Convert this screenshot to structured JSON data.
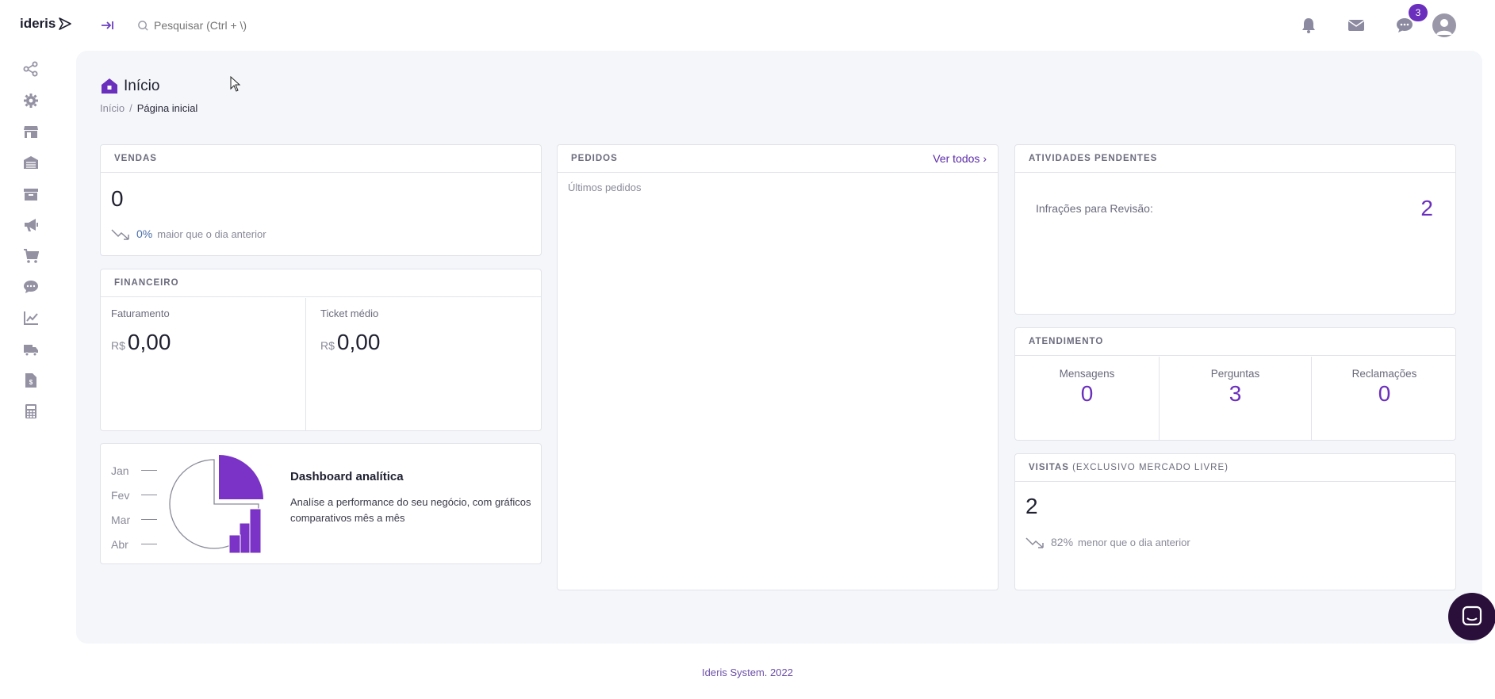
{
  "app": {
    "logo": "ideris"
  },
  "search": {
    "placeholder": "Pesquisar (Ctrl + \\)"
  },
  "header": {
    "chat_badge": "3"
  },
  "sidebar": {
    "items": [
      {
        "icon": "share-icon"
      },
      {
        "icon": "gear-icon"
      },
      {
        "icon": "store-icon"
      },
      {
        "icon": "warehouse-icon"
      },
      {
        "icon": "archive-icon"
      },
      {
        "icon": "megaphone-icon"
      },
      {
        "icon": "cart-icon"
      },
      {
        "icon": "chat-icon"
      },
      {
        "icon": "chart-line-icon"
      },
      {
        "icon": "truck-icon"
      },
      {
        "icon": "invoice-icon"
      },
      {
        "icon": "calculator-icon"
      }
    ]
  },
  "page": {
    "title": "Início",
    "breadcrumb": {
      "root": "Início",
      "separator": "/",
      "current": "Página inicial"
    }
  },
  "vendas": {
    "header": "VENDAS",
    "value": "0",
    "trend_pct": "0%",
    "trend_text": "maior que o dia anterior"
  },
  "financeiro": {
    "header": "FINANCEIRO",
    "faturamento_label": "Faturamento",
    "faturamento_currency": "R$",
    "faturamento_value": "0,00",
    "ticket_label": "Ticket médio",
    "ticket_currency": "R$",
    "ticket_value": "0,00"
  },
  "promo": {
    "months": [
      "Jan",
      "Fev",
      "Mar",
      "Abr"
    ],
    "title": "Dashboard analítica",
    "description": "Analíse a performance do seu negócio, com gráficos comparativos mês a mês"
  },
  "pedidos": {
    "header": "PEDIDOS",
    "link": "Ver todos",
    "subtitle": "Últimos pedidos"
  },
  "atividades": {
    "header": "ATIVIDADES PENDENTES",
    "label": "Infrações para Revisão:",
    "value": "2"
  },
  "atendimento": {
    "header": "ATENDIMENTO",
    "items": [
      {
        "label": "Mensagens",
        "value": "0"
      },
      {
        "label": "Perguntas",
        "value": "3"
      },
      {
        "label": "Reclamações",
        "value": "0"
      }
    ]
  },
  "visitas": {
    "header": "VISITAS",
    "header_sub": "(EXCLUSIVO MERCADO LIVRE)",
    "value": "2",
    "trend_pct": "82%",
    "trend_text": "menor que o dia anterior"
  },
  "footer": {
    "text": "Ideris System. 2022"
  },
  "colors": {
    "accent": "#6b2fbd",
    "background": "#f4f6fa"
  }
}
